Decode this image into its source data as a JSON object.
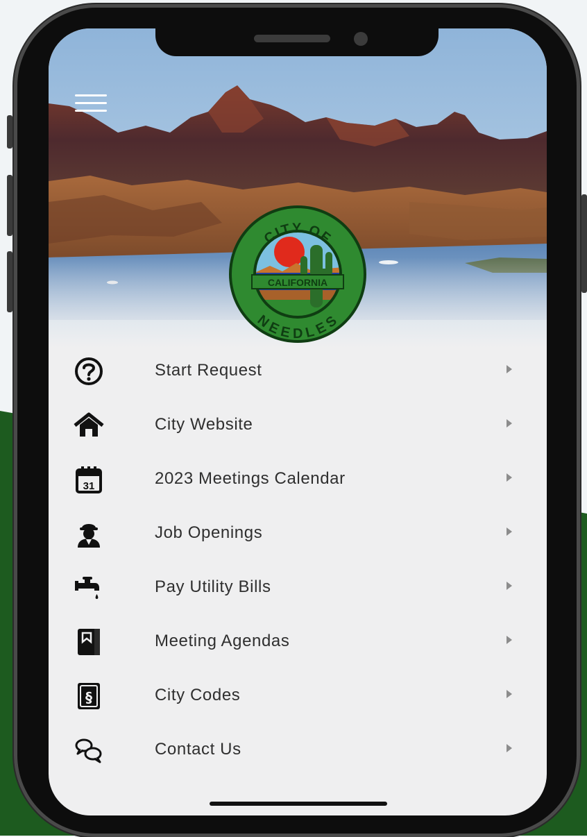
{
  "app": {
    "seal": {
      "text_top": "CITY OF",
      "text_middle": "CALIFORNIA",
      "text_bottom": "NEEDLES"
    },
    "menu": [
      {
        "label": "Start Request",
        "icon": "question-circle-icon"
      },
      {
        "label": "City Website",
        "icon": "home-icon"
      },
      {
        "label": "2023 Meetings Calendar",
        "icon": "calendar-31-icon"
      },
      {
        "label": "Job Openings",
        "icon": "worker-icon"
      },
      {
        "label": "Pay Utility Bills",
        "icon": "faucet-icon"
      },
      {
        "label": "Meeting Agendas",
        "icon": "bookmark-book-icon"
      },
      {
        "label": "City Codes",
        "icon": "section-sign-icon"
      },
      {
        "label": "Contact Us",
        "icon": "chat-bubbles-icon"
      }
    ],
    "calendar_day": "31",
    "section_symbol": "§"
  },
  "colors": {
    "background": "#f1f4f6",
    "brand_green": "#1d5b1f",
    "menu_background": "#efeff0",
    "menu_text": "#2f2f2f",
    "arrow": "#8c8c8c"
  }
}
